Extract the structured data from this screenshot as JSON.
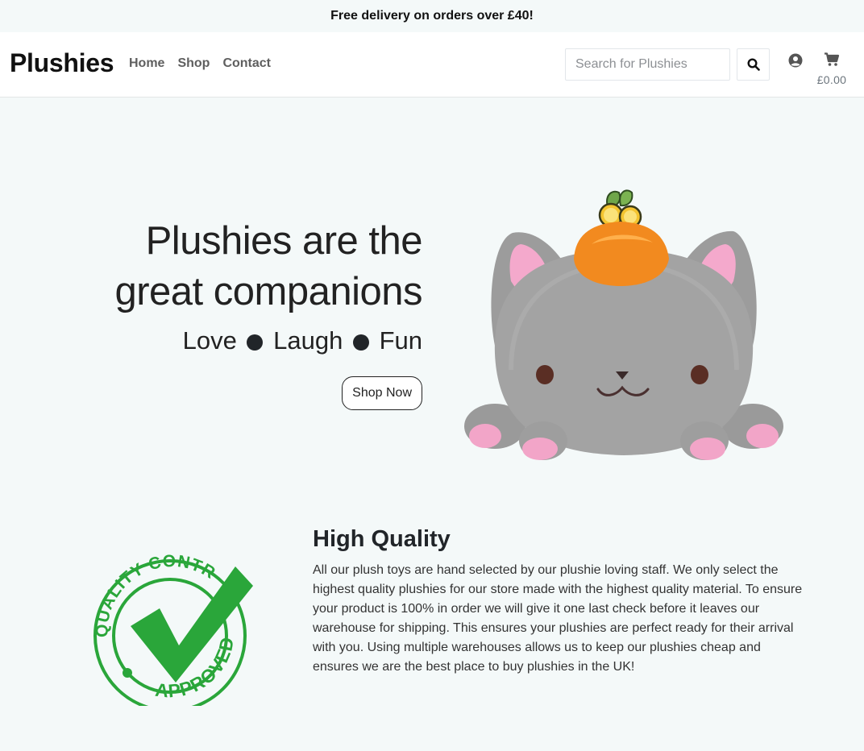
{
  "promo": {
    "text": "Free delivery on orders over £40!"
  },
  "nav": {
    "brand": "Plushies",
    "links": [
      {
        "label": "Home"
      },
      {
        "label": "Shop"
      },
      {
        "label": "Contact"
      }
    ],
    "search_placeholder": "Search for Plushies",
    "cart_total": "£0.00"
  },
  "hero": {
    "title_line1": "Plushies are the",
    "title_line2": "great companions",
    "tagline": [
      "Love",
      "Laugh",
      "Fun"
    ],
    "cta_label": "Shop Now"
  },
  "quality": {
    "title": "High Quality",
    "body": "All our plush toys are hand selected by our plushie loving staff. We only select the highest quality plushies for our store made with the highest quality material. To ensure your product is 100% in order we will give it one last check before it leaves our warehouse for shipping. This ensures your plushies are perfect ready for their arrival with you. Using multiple warehouses allows us to keep our plushies cheap and ensures we are the best place to buy plushies in the UK!",
    "badge_text_top": "QUALITY CONTROL",
    "badge_text_bottom": "APPROVED"
  },
  "colors": {
    "page_bg": "#f4f9f9",
    "badge_green": "#2aa63a",
    "plush_gray": "#9e9e9e",
    "plush_pink": "#f2a5c8",
    "plush_orange": "#f28a1f"
  },
  "icons": {
    "search": "search-icon",
    "account": "user-circle-icon",
    "cart": "shopping-cart-icon"
  }
}
